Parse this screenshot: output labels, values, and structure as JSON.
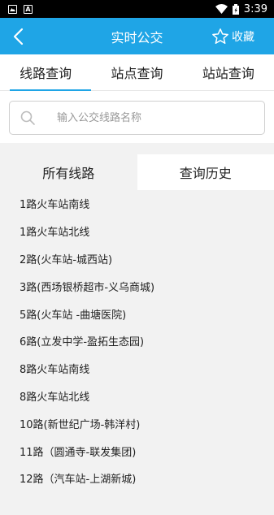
{
  "status_bar": {
    "left_icons": [
      "image-icon",
      "a-icon"
    ],
    "time": "3:39"
  },
  "app_bar": {
    "title": "实时公交",
    "favorite_label": "收藏"
  },
  "tabs": [
    {
      "label": "线路查询",
      "active": true
    },
    {
      "label": "站点查询",
      "active": false
    },
    {
      "label": "站站查询",
      "active": false
    }
  ],
  "search": {
    "placeholder": "输入公交线路名称",
    "value": ""
  },
  "sub_tabs": [
    {
      "label": "所有线路",
      "active": true
    },
    {
      "label": "查询历史",
      "active": false
    }
  ],
  "routes": [
    "1路火车站南线",
    "1路火车站北线",
    "2路(火车站-城西站)",
    "3路(西场银桥超市-义乌商城)",
    "5路(火车站 -曲塘医院)",
    "6路(立发中学-盈拓生态园)",
    "8路火车站南线",
    "8路火车站北线",
    "10路(新世纪广场-韩洋村)",
    "11路（圆通寺-联发集团)",
    "12路（汽车站-上湖新城)"
  ],
  "colors": {
    "primary": "#1fa5e6",
    "list_bg": "#f2f2f2"
  }
}
